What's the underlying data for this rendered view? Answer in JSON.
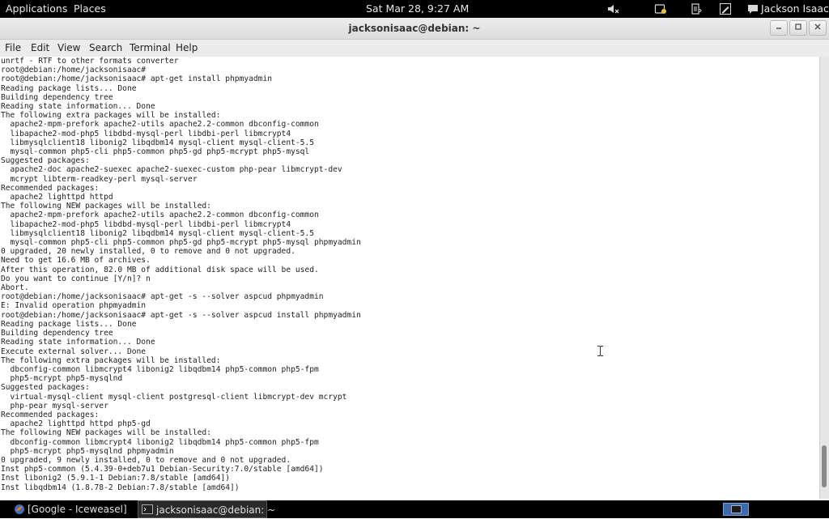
{
  "top_panel": {
    "applications": "Applications",
    "places": "Places",
    "clock": "Sat Mar 28,  9:27 AM",
    "user": "Jackson Isaac"
  },
  "window": {
    "title": "jacksonisaac@debian: ~"
  },
  "menubar": {
    "file": "File",
    "edit": "Edit",
    "view": "View",
    "search": "Search",
    "terminal": "Terminal",
    "help": "Help"
  },
  "terminal": {
    "lines": [
      "unrtf - RTF to other formats converter",
      "root@debian:/home/jacksonisaac#",
      "root@debian:/home/jacksonisaac# apt-get install phpmyadmin",
      "Reading package lists... Done",
      "Building dependency tree",
      "Reading state information... Done",
      "The following extra packages will be installed:",
      "  apache2-mpm-prefork apache2-utils apache2.2-common dbconfig-common",
      "  libapache2-mod-php5 libdbd-mysql-perl libdbi-perl libmcrypt4",
      "  libmysqlclient18 libonig2 libqdbm14 mysql-client mysql-client-5.5",
      "  mysql-common php5-cli php5-common php5-gd php5-mcrypt php5-mysql",
      "Suggested packages:",
      "  apache2-doc apache2-suexec apache2-suexec-custom php-pear libmcrypt-dev",
      "  mcrypt libterm-readkey-perl mysql-server",
      "Recommended packages:",
      "  apache2 lighttpd httpd",
      "The following NEW packages will be installed:",
      "  apache2-mpm-prefork apache2-utils apache2.2-common dbconfig-common",
      "  libapache2-mod-php5 libdbd-mysql-perl libdbi-perl libmcrypt4",
      "  libmysqlclient18 libonig2 libqdbm14 mysql-client mysql-client-5.5",
      "  mysql-common php5-cli php5-common php5-gd php5-mcrypt php5-mysql phpmyadmin",
      "0 upgraded, 20 newly installed, 0 to remove and 0 not upgraded.",
      "Need to get 16.6 MB of archives.",
      "After this operation, 82.0 MB of additional disk space will be used.",
      "Do you want to continue [Y/n]? n",
      "Abort.",
      "root@debian:/home/jacksonisaac# apt-get -s --solver aspcud phpmyadmin",
      "E: Invalid operation phpmyadmin",
      "root@debian:/home/jacksonisaac# apt-get -s --solver aspcud install phpmyadmin",
      "Reading package lists... Done",
      "Building dependency tree",
      "Reading state information... Done",
      "Execute external solver... Done",
      "The following extra packages will be installed:",
      "  dbconfig-common libmcrypt4 libonig2 libqdbm14 php5-common php5-fpm",
      "  php5-mcrypt php5-mysqlnd",
      "Suggested packages:",
      "  virtual-mysql-client mysql-client postgresql-client libmcrypt-dev mcrypt",
      "  php-pear mysql-server",
      "Recommended packages:",
      "  apache2 lighttpd httpd php5-gd",
      "The following NEW packages will be installed:",
      "  dbconfig-common libmcrypt4 libonig2 libqdbm14 php5-common php5-fpm",
      "  php5-mcrypt php5-mysqlnd phpmyadmin",
      "0 upgraded, 9 newly installed, 0 to remove and 0 not upgraded.",
      "Inst php5-common (5.4.39-0+deb7u1 Debian-Security:7.0/stable [amd64])",
      "Inst libonig2 (5.9.1-1 Debian:7.8/stable [amd64])",
      "Inst libqdbm14 (1.8.78-2 Debian:7.8/stable [amd64])"
    ]
  },
  "taskbar": {
    "task1": "[Google - Iceweasel]",
    "task2": "jacksonisaac@debian: ~"
  },
  "icons": {
    "volume": "volume-muted-icon",
    "notifications": "notification-icon",
    "clipboard": "clipboard-icon",
    "edit": "pen-icon",
    "chat": "chat-bubble-icon",
    "browser": "iceweasel-icon",
    "terminal": "terminal-icon"
  },
  "colors": {
    "panel": "#000000",
    "terminal_bg": "#ffffff",
    "terminal_fg": "#222222"
  }
}
